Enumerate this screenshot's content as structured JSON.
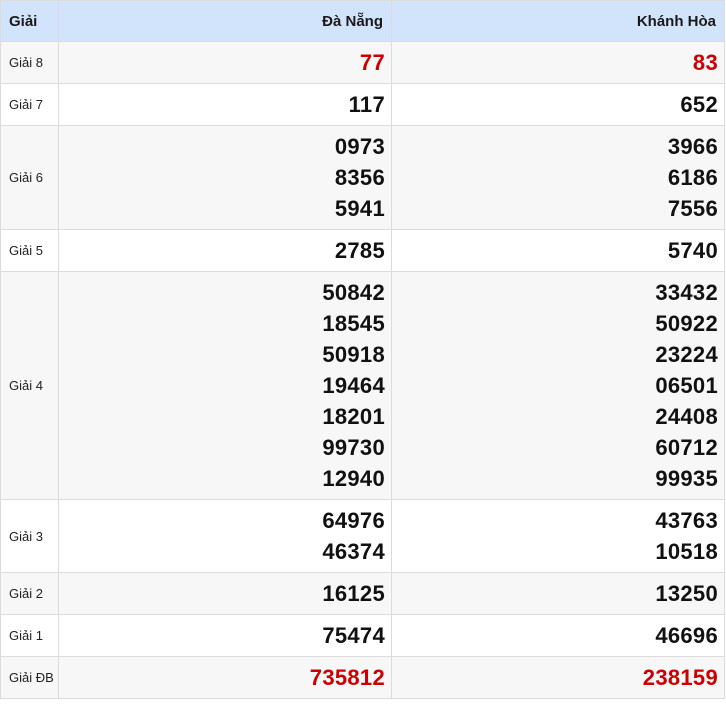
{
  "header": {
    "prize": "Giải",
    "city1": "Đà Nẵng",
    "city2": "Khánh Hòa"
  },
  "colors": {
    "header_bg": "#d2e3fc",
    "highlight": "#cc0000"
  },
  "rows": [
    {
      "label": "Giải 8",
      "red": true,
      "c1": [
        "77"
      ],
      "c2": [
        "83"
      ]
    },
    {
      "label": "Giải 7",
      "red": false,
      "c1": [
        "117"
      ],
      "c2": [
        "652"
      ]
    },
    {
      "label": "Giải 6",
      "red": false,
      "c1": [
        "0973",
        "8356",
        "5941"
      ],
      "c2": [
        "3966",
        "6186",
        "7556"
      ]
    },
    {
      "label": "Giải 5",
      "red": false,
      "c1": [
        "2785"
      ],
      "c2": [
        "5740"
      ]
    },
    {
      "label": "Giải 4",
      "red": false,
      "c1": [
        "50842",
        "18545",
        "50918",
        "19464",
        "18201",
        "99730",
        "12940"
      ],
      "c2": [
        "33432",
        "50922",
        "23224",
        "06501",
        "24408",
        "60712",
        "99935"
      ]
    },
    {
      "label": "Giải 3",
      "red": false,
      "c1": [
        "64976",
        "46374"
      ],
      "c2": [
        "43763",
        "10518"
      ]
    },
    {
      "label": "Giải 2",
      "red": false,
      "c1": [
        "16125"
      ],
      "c2": [
        "13250"
      ]
    },
    {
      "label": "Giải 1",
      "red": false,
      "c1": [
        "75474"
      ],
      "c2": [
        "46696"
      ]
    },
    {
      "label": "Giải ĐB",
      "red": true,
      "c1": [
        "735812"
      ],
      "c2": [
        "238159"
      ]
    }
  ]
}
